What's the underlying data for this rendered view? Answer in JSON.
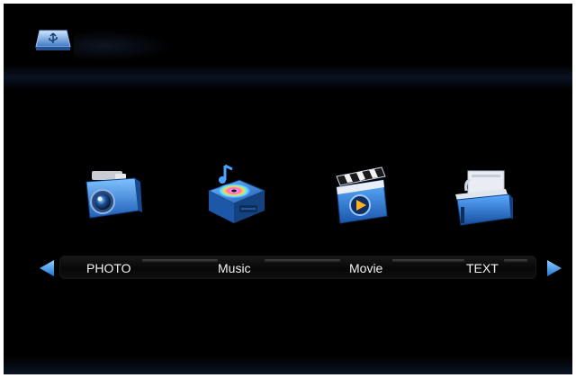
{
  "menu": {
    "items": [
      {
        "label": "PHOTO",
        "icon": "camera-icon"
      },
      {
        "label": "Music",
        "icon": "music-disc-icon"
      },
      {
        "label": "Movie",
        "icon": "clapperboard-icon"
      },
      {
        "label": "TEXT",
        "icon": "document-tray-icon"
      }
    ]
  },
  "source": {
    "icon": "usb-drive-icon"
  },
  "nav": {
    "left_icon": "arrow-left-icon",
    "right_icon": "arrow-right-icon"
  },
  "colors": {
    "background": "#000000",
    "accent_blue": "#2f8fe0",
    "label_text": "#f2f2f2"
  }
}
